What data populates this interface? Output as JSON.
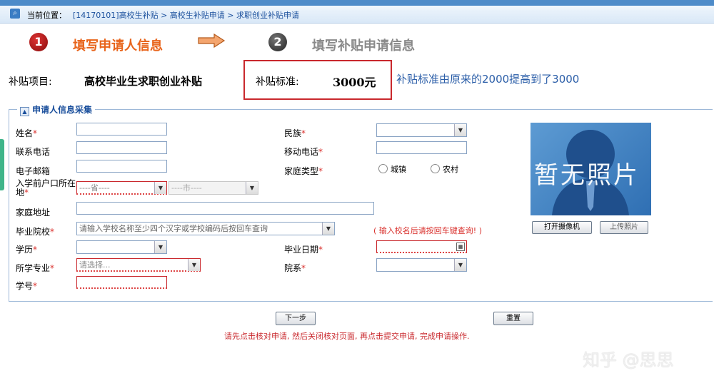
{
  "breadcrumb": {
    "label": "当前位置：",
    "path": "[14170101]高校生补贴 > 高校生补贴申请 > 求职创业补贴申请"
  },
  "steps": [
    {
      "number": "1",
      "label": "填写申请人信息"
    },
    {
      "number": "2",
      "label": "填写补贴申请信息"
    }
  ],
  "subsidy": {
    "item_label": "补贴项目:",
    "item_value": "高校毕业生求职创业补贴",
    "standard_label": "补贴标准:",
    "standard_value": "3000元",
    "note": "补贴标准由原来的2000提高到了3000"
  },
  "section_title": "申请人信息采集",
  "form": {
    "name_label": "姓名",
    "phone_label": "联系电话",
    "email_label": "电子邮箱",
    "hukou_label_1": "入学前户口所在",
    "hukou_label_2": "地",
    "province_placeholder": "----省----",
    "city_placeholder": "----市----",
    "address_label": "家庭地址",
    "school_label": "毕业院校",
    "school_placeholder": "请输入学校名称至少四个汉字或学校编码后按回车查询",
    "school_hint": "( 输入校名后请按回车键查询! )",
    "education_label": "学历",
    "major_label": "所学专业",
    "major_placeholder": "请选择...",
    "student_id_label": "学号",
    "ethnicity_label": "民族",
    "mobile_label": "移动电话",
    "household_label": "家庭类型",
    "household_options": [
      "城镇",
      "农村"
    ],
    "grad_date_label": "毕业日期",
    "department_label": "院系",
    "required_mark": "*"
  },
  "photo": {
    "placeholder_text": "暂无照片",
    "open_camera": "打开摄像机",
    "upload": "上传照片"
  },
  "actions": {
    "next": "下一步",
    "reset": "重置",
    "footer_message": "请先点击核对申请, 然后关闭核对页面, 再点击提交申请, 完成申请操作."
  },
  "watermark": "知乎 @思思",
  "colors": {
    "accent_blue": "#1a4f9c",
    "step_active": "#e8641b",
    "error_red": "#c9282d"
  }
}
